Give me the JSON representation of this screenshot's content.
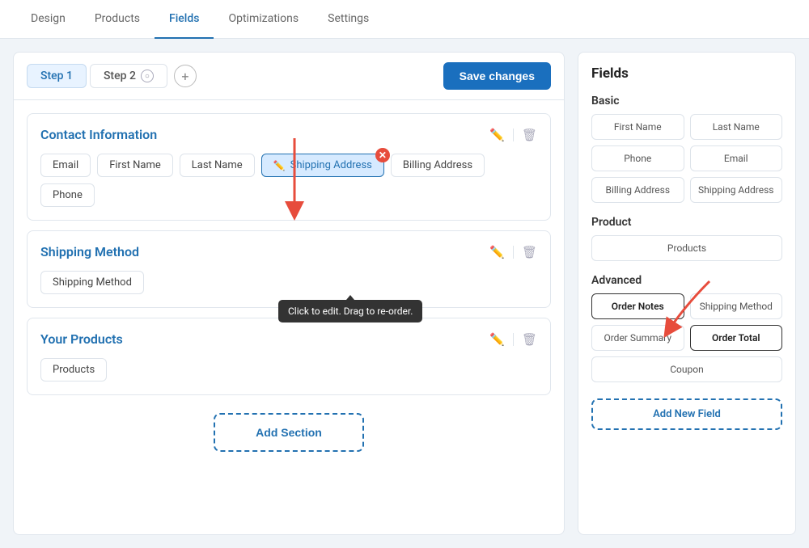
{
  "topNav": {
    "items": [
      {
        "label": "Design",
        "active": false
      },
      {
        "label": "Products",
        "active": false
      },
      {
        "label": "Fields",
        "active": true
      },
      {
        "label": "Optimizations",
        "active": false
      },
      {
        "label": "Settings",
        "active": false
      }
    ]
  },
  "stepTabs": {
    "step1": {
      "label": "Step 1",
      "active": true
    },
    "step2": {
      "label": "Step 2",
      "active": false
    },
    "addLabel": "+",
    "saveLabel": "Save changes"
  },
  "sections": [
    {
      "id": "contact",
      "title": "Contact Information",
      "fields": [
        {
          "label": "Email",
          "active": false
        },
        {
          "label": "First Name",
          "active": false
        },
        {
          "label": "Last Name",
          "active": false
        },
        {
          "label": "Shipping Address",
          "active": true
        },
        {
          "label": "Billing Address",
          "active": false
        }
      ],
      "extraFields": [
        {
          "label": "Phone",
          "active": false
        }
      ]
    },
    {
      "id": "shipping",
      "title": "Shipping Method",
      "fields": [
        {
          "label": "Shipping Method",
          "active": false
        }
      ],
      "extraFields": []
    },
    {
      "id": "products",
      "title": "Your Products",
      "fields": [
        {
          "label": "Products",
          "active": false
        }
      ],
      "extraFields": []
    }
  ],
  "tooltip": {
    "text": "Click to edit. Drag to re-order."
  },
  "addSection": {
    "label": "Add Section"
  },
  "rightPanel": {
    "title": "Fields",
    "groups": [
      {
        "label": "Basic",
        "fields": [
          {
            "label": "First Name",
            "highlighted": false
          },
          {
            "label": "Last Name",
            "highlighted": false
          },
          {
            "label": "Phone",
            "highlighted": false
          },
          {
            "label": "Email",
            "highlighted": false
          },
          {
            "label": "Billing Address",
            "highlighted": false
          },
          {
            "label": "Shipping Address",
            "highlighted": false
          }
        ]
      },
      {
        "label": "Product",
        "fields": [
          {
            "label": "Products",
            "highlighted": false,
            "wide": true
          }
        ]
      },
      {
        "label": "Advanced",
        "fields": [
          {
            "label": "Order Notes",
            "highlighted": true
          },
          {
            "label": "Shipping Method",
            "highlighted": false
          },
          {
            "label": "Order Summary",
            "highlighted": false
          },
          {
            "label": "Order Total",
            "highlighted": true
          },
          {
            "label": "Coupon",
            "highlighted": false,
            "wide": true
          }
        ]
      }
    ],
    "addNewField": "Add New Field"
  }
}
